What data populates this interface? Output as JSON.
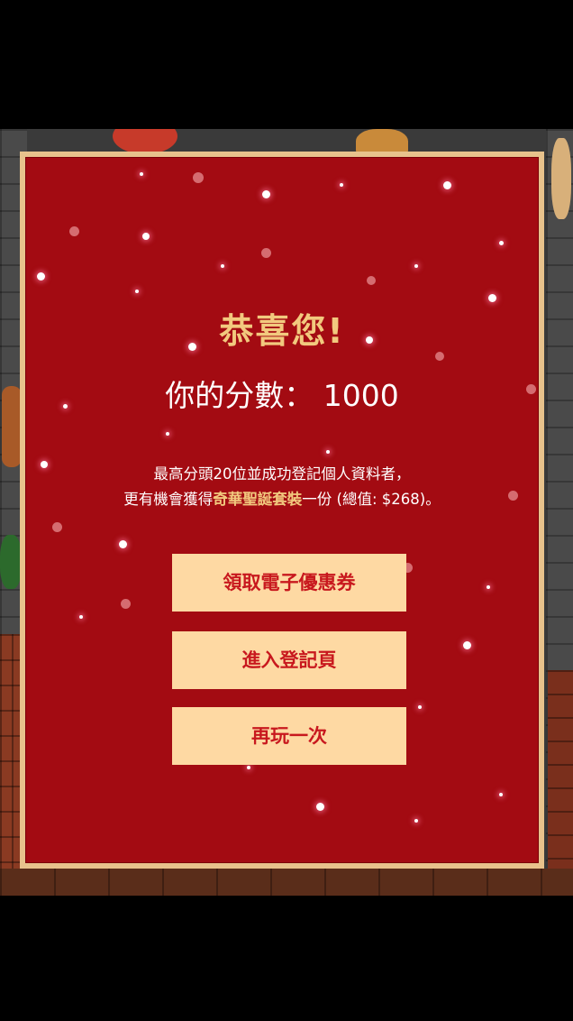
{
  "dialog": {
    "title": "恭喜您!",
    "score_label": "你的分數：",
    "score_value": "1000",
    "description_line1": "最高分頭20位並成功登記個人資料者，",
    "description_line2_prefix": "更有機會獲得",
    "description_line2_highlight": "奇華聖誕套裝",
    "description_line2_suffix": "一份 (總值: $268)。"
  },
  "buttons": {
    "coupon": "領取電子優惠券",
    "register": "進入登記頁",
    "replay": "再玩一次"
  },
  "colors": {
    "panel_bg": "#a30b12",
    "panel_border": "#e8c28c",
    "title_gold": "#f2c97e",
    "button_bg": "#fed9a3",
    "button_text": "#c8181e"
  }
}
